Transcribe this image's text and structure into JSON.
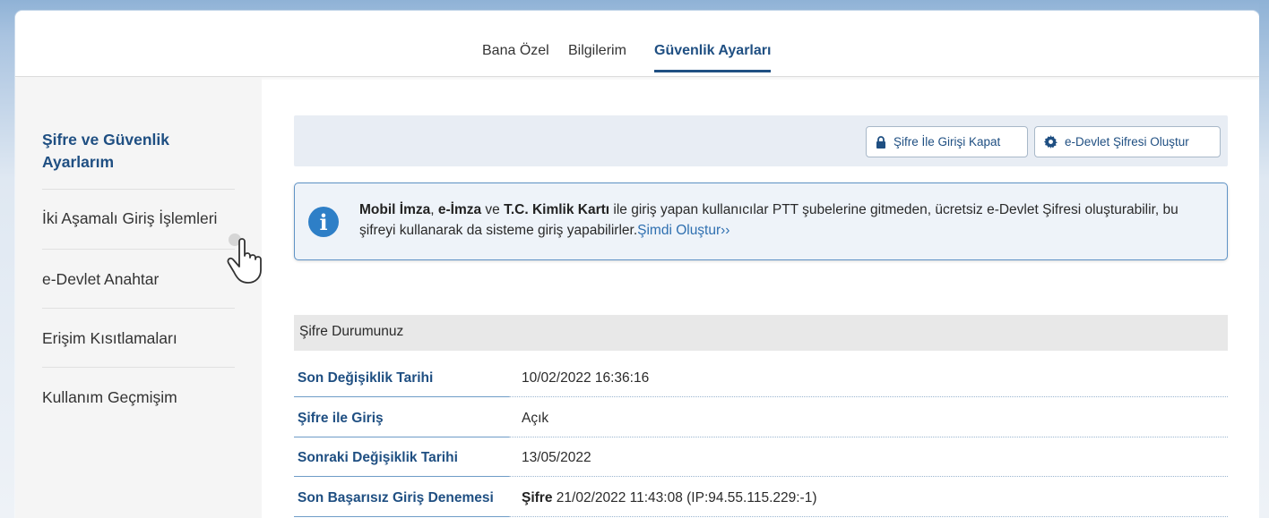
{
  "topnav": {
    "tabs": [
      {
        "label": "Bana Özel",
        "active": false
      },
      {
        "label": "Bilgilerim",
        "active": false
      },
      {
        "label": "Güvenlik Ayarları",
        "active": true
      }
    ]
  },
  "sidebar": {
    "items": [
      {
        "label": "Şifre ve Güvenlik Ayarlarım",
        "active": true
      },
      {
        "label": "İki Aşamalı Giriş İşlemleri",
        "active": false
      },
      {
        "label": "e-Devlet Anahtar",
        "active": false
      },
      {
        "label": "Erişim Kısıtlamaları",
        "active": false
      },
      {
        "label": "Kullanım Geçmişim",
        "active": false
      }
    ]
  },
  "toolbar": {
    "close_password_login": {
      "label": "Şifre İle Girişi Kapat",
      "icon": "lock-icon"
    },
    "create_password": {
      "label": "e-Devlet Şifresi Oluştur",
      "icon": "gear-icon"
    }
  },
  "info": {
    "icon": "info-icon",
    "bold1": "Mobil İmza",
    "sep1": ", ",
    "bold2": "e-İmza",
    "sep2": " ve ",
    "bold3": "T.C. Kimlik Kartı",
    "text": " ile giriş yapan kullanıcılar PTT şubelerine gitmeden, ücretsiz e-Devlet Şifresi oluşturabilir, bu şifreyi kullanarak da sisteme giriş yapabilirler.",
    "link": "Şimdi Oluştur››"
  },
  "password_status": {
    "heading": "Şifre Durumunuz",
    "rows": [
      {
        "label": "Son Değişiklik Tarihi",
        "value": "10/02/2022 16:36:16"
      },
      {
        "label": "Şifre ile Giriş",
        "value": "Açık"
      },
      {
        "label": "Sonraki Değişiklik Tarihi",
        "value": "13/05/2022"
      },
      {
        "label": "Son Başarısız Giriş Denemesi",
        "value_bold": "Şifre",
        "value": " 21/02/2022 11:43:08 (IP:94.55.115.229:-1)"
      }
    ]
  },
  "colors": {
    "primary": "#1f4f82",
    "link": "#2e6fb0",
    "info_border": "#5f93c6",
    "info_icon": "#2e7fc7"
  }
}
